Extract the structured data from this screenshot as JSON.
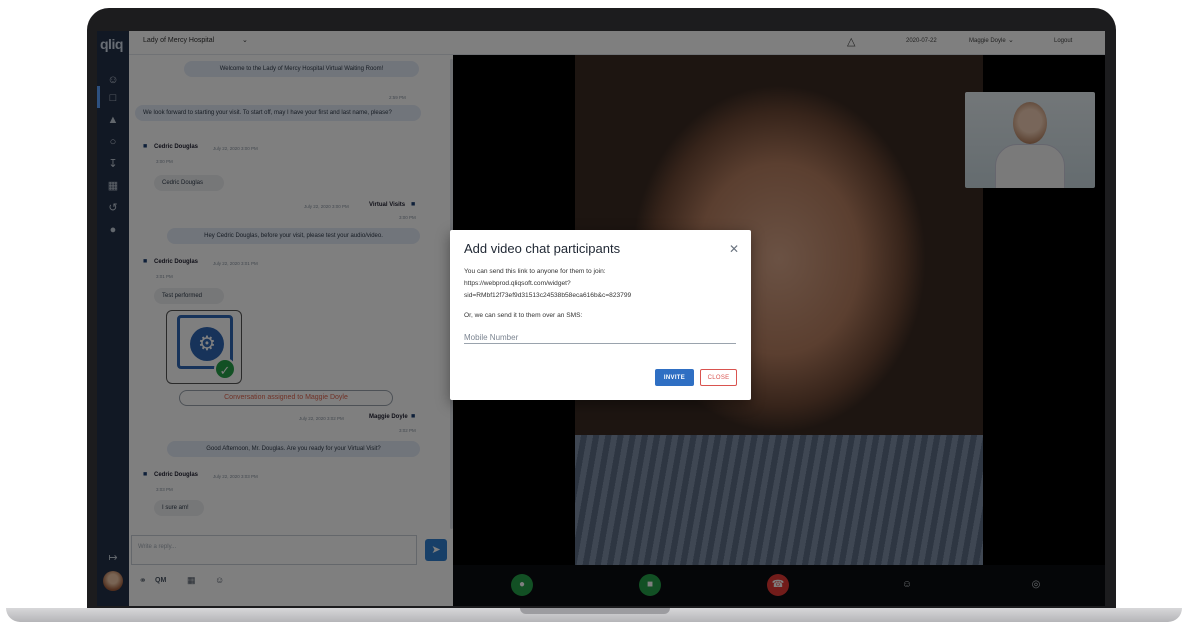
{
  "brand": {
    "logo": "qliq"
  },
  "topbar": {
    "hospital": "Lady of Mercy Hospital",
    "date": "2020-07-22",
    "user": "Maggie Doyle",
    "logout": "Logout"
  },
  "chat": {
    "messages": [
      {
        "text": "Welcome to the Lady of Mercy Hospital Virtual Waiting Room!"
      },
      {
        "time": "2:59 PM"
      },
      {
        "text": "We look forward to starting your visit. To start off, may I have your first and last name, please?"
      },
      {
        "sender": "Cedric Douglas",
        "meta": "July 22, 2020 3:00 PM",
        "time": "3:00 PM",
        "text": "Cedric Douglas"
      },
      {
        "sender": "Virtual Visits",
        "meta": "July 22, 2020 3:00 PM",
        "time": "3:00 PM",
        "text": "Hey Cedric Douglas, before your visit, please test your audio/video."
      },
      {
        "sender": "Cedric Douglas",
        "meta": "July 22, 2020 3:01 PM",
        "time": "3:01 PM",
        "text": "Test performed"
      },
      {
        "sender": "Maggie Doyle",
        "meta": "July 22, 2020 3:02 PM",
        "time": "3:02 PM",
        "text": "Good Afternoon, Mr. Douglas. Are you ready for your Virtual Visit?"
      },
      {
        "sender": "Cedric Douglas",
        "meta": "July 22, 2020 3:03 PM",
        "time": "3:03 PM",
        "text": "I sure am!"
      }
    ],
    "assigned": "Conversation assigned to Maggie Doyle",
    "composer_placeholder": "Write a reply...",
    "tools": {
      "qm": "QM"
    }
  },
  "modal": {
    "title": "Add video chat participants",
    "line1": "You can send this link to anyone for them to join:",
    "line2": "https://webprod.qliqsoft.com/widget?",
    "line3": "sid=RMbf12f73ef9d31513c24538b58eca616b&c=823799",
    "line4": "Or, we can send it to them over an SMS:",
    "mobile_placeholder": "Mobile Number",
    "invite": "INVITE",
    "close": "CLOSE"
  },
  "colors": {
    "accent": "#2f6fc3",
    "danger": "#d9534f",
    "rail": "#233049"
  }
}
